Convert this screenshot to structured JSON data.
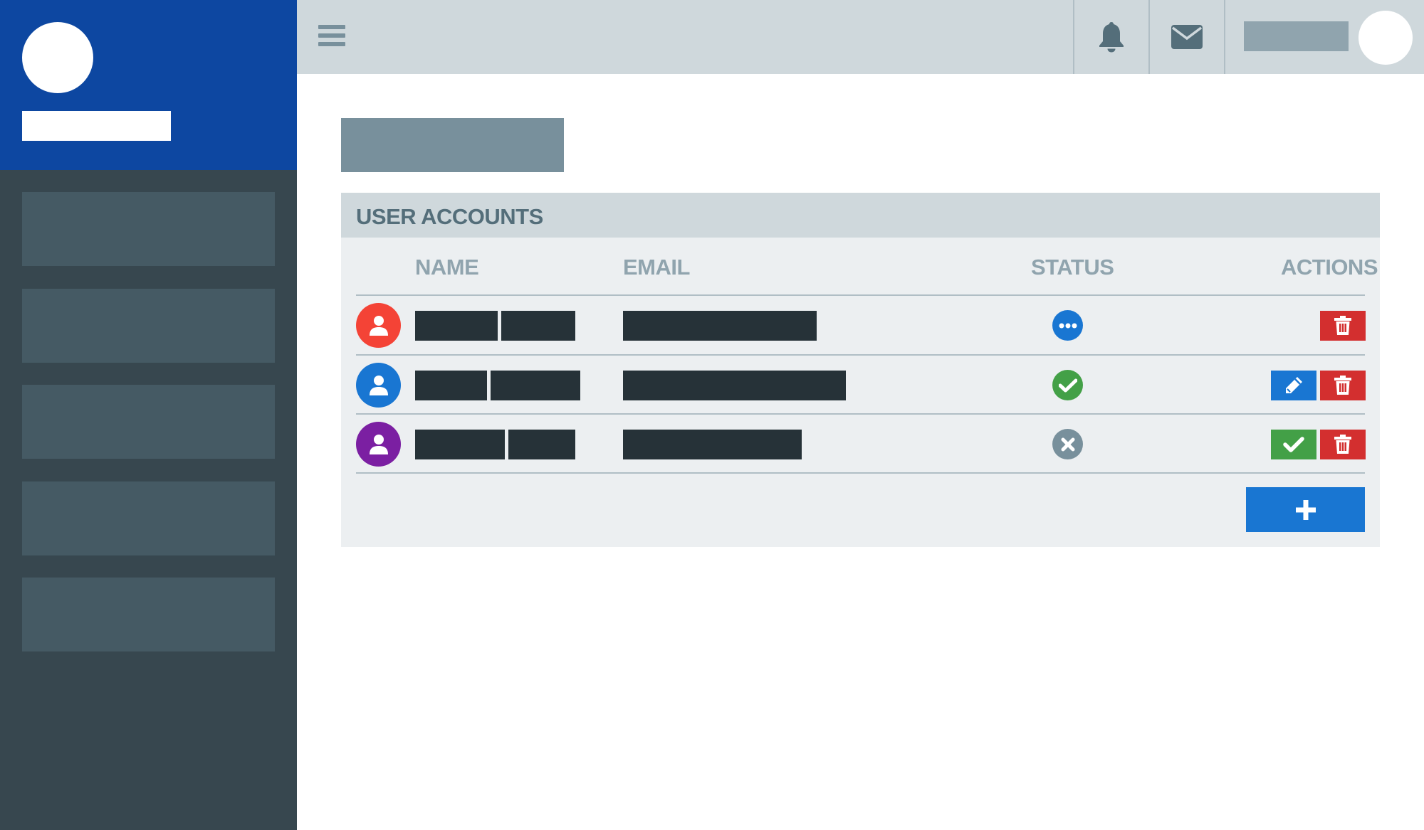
{
  "colors": {
    "brand": "#0d47a1",
    "sidebar": "#37474f",
    "topbar": "#cfd8dc",
    "panel": "#eceff1",
    "primary": "#1976d2",
    "success": "#43a047",
    "danger": "#d32f2f",
    "muted": "#78909c"
  },
  "sidebar": {
    "items": [
      {
        "name": "sidebar-item-1"
      },
      {
        "name": "sidebar-item-2"
      },
      {
        "name": "sidebar-item-3"
      },
      {
        "name": "sidebar-item-4"
      },
      {
        "name": "sidebar-item-5"
      }
    ]
  },
  "topbar": {
    "icons": [
      "hamburger-menu-icon",
      "bell-icon",
      "envelope-icon"
    ]
  },
  "panel": {
    "title": "USER ACCOUNTS",
    "columns": {
      "name": "NAME",
      "email": "EMAIL",
      "status": "STATUS",
      "actions": "ACTIONS"
    },
    "rows": [
      {
        "avatar_color": "#f44336",
        "status": "pending",
        "status_icon": "ellipsis-icon",
        "status_color": "#1976d2",
        "actions": [
          "delete"
        ]
      },
      {
        "avatar_color": "#1976d2",
        "status": "active",
        "status_icon": "check-icon",
        "status_color": "#43a047",
        "actions": [
          "edit",
          "delete"
        ]
      },
      {
        "avatar_color": "#7b1fa2",
        "status": "inactive",
        "status_icon": "close-icon",
        "status_color": "#78909c",
        "actions": [
          "approve",
          "delete"
        ]
      }
    ],
    "add_button_icon": "plus-icon"
  }
}
